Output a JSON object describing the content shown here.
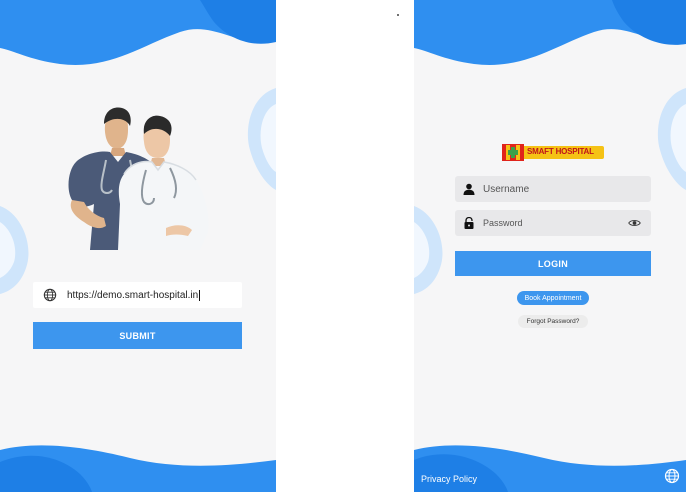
{
  "url_screen": {
    "url_value": "https://demo.smart-hospital.in",
    "submit_label": "SUBMIT"
  },
  "login_screen": {
    "brand": "SMAFT HOSPITAL",
    "username_placeholder": "Username",
    "password_placeholder": "Password",
    "login_label": "LOGIN",
    "book_appointment_label": "Book Appointment",
    "forgot_password_label": "Forgot Password?",
    "privacy_policy_label": "Privacy Policy"
  },
  "colors": {
    "accent": "#2f8ff0",
    "button": "#3d96ee",
    "background": "#f6f6f7",
    "brand_yellow": "#f5c215",
    "brand_red": "#e0241b"
  }
}
